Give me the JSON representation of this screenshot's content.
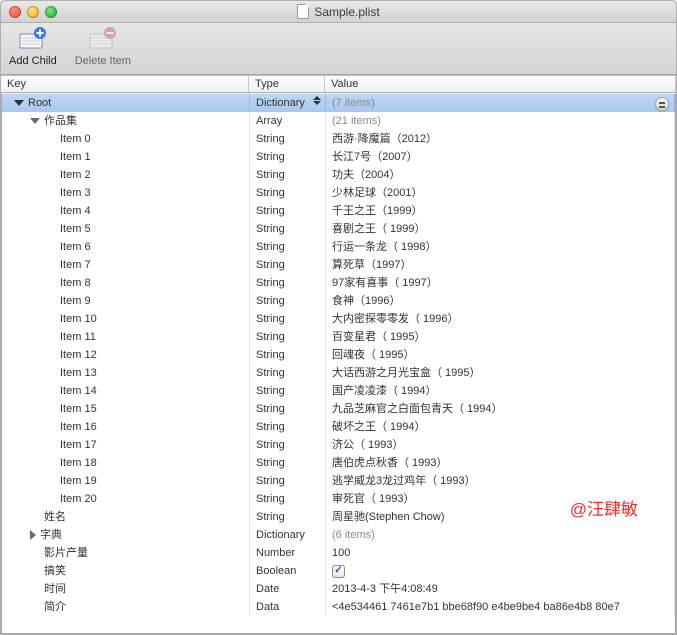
{
  "title": "Sample.plist",
  "toolbar": {
    "add_child": "Add Child",
    "delete_item": "Delete Item"
  },
  "columns": {
    "key": "Key",
    "type": "Type",
    "value": "Value"
  },
  "rows": [
    {
      "depth": 0,
      "disclosure": "down",
      "selected": true,
      "key": "Root",
      "type": "Dictionary",
      "value": "(7 items)",
      "value_dim": true,
      "interactable": true
    },
    {
      "depth": 1,
      "disclosure": "down",
      "key": "作品集",
      "type": "Array",
      "value": "(21 items)",
      "value_dim": true,
      "interactable": true
    },
    {
      "depth": 2,
      "key": "Item 0",
      "type": "String",
      "value": "西游·降魔篇（2012）",
      "interactable": true
    },
    {
      "depth": 2,
      "key": "Item 1",
      "type": "String",
      "value": "长江7号（2007）",
      "interactable": true
    },
    {
      "depth": 2,
      "key": "Item 2",
      "type": "String",
      "value": "功夫（2004）",
      "interactable": true
    },
    {
      "depth": 2,
      "key": "Item 3",
      "type": "String",
      "value": "少林足球（2001）",
      "interactable": true
    },
    {
      "depth": 2,
      "key": "Item 4",
      "type": "String",
      "value": "千王之王（1999）",
      "interactable": true
    },
    {
      "depth": 2,
      "key": "Item 5",
      "type": "String",
      "value": "喜剧之王（ 1999）",
      "interactable": true
    },
    {
      "depth": 2,
      "key": "Item 6",
      "type": "String",
      "value": "行运一条龙（ 1998）",
      "interactable": true
    },
    {
      "depth": 2,
      "key": "Item 7",
      "type": "String",
      "value": "算死草（1997）",
      "interactable": true
    },
    {
      "depth": 2,
      "key": "Item 8",
      "type": "String",
      "value": "97家有喜事（ 1997）",
      "interactable": true
    },
    {
      "depth": 2,
      "key": "Item 9",
      "type": "String",
      "value": "食神（1996）",
      "interactable": true
    },
    {
      "depth": 2,
      "key": "Item 10",
      "type": "String",
      "value": "大内密探零零发（ 1996）",
      "interactable": true
    },
    {
      "depth": 2,
      "key": "Item 11",
      "type": "String",
      "value": "百变星君（ 1995）",
      "interactable": true
    },
    {
      "depth": 2,
      "key": "Item 12",
      "type": "String",
      "value": "回魂夜（ 1995）",
      "interactable": true
    },
    {
      "depth": 2,
      "key": "Item 13",
      "type": "String",
      "value": "大话西游之月光宝盒（ 1995）",
      "interactable": true
    },
    {
      "depth": 2,
      "key": "Item 14",
      "type": "String",
      "value": "国产凌凌漆（ 1994）",
      "interactable": true
    },
    {
      "depth": 2,
      "key": "Item 15",
      "type": "String",
      "value": "九品芝麻官之白面包青天（ 1994）",
      "interactable": true
    },
    {
      "depth": 2,
      "key": "Item 16",
      "type": "String",
      "value": "破坏之王（ 1994）",
      "interactable": true
    },
    {
      "depth": 2,
      "key": "Item 17",
      "type": "String",
      "value": "济公（ 1993）",
      "interactable": true
    },
    {
      "depth": 2,
      "key": "Item 18",
      "type": "String",
      "value": "唐伯虎点秋香（ 1993）",
      "interactable": true
    },
    {
      "depth": 2,
      "key": "Item 19",
      "type": "String",
      "value": "逃学威龙3龙过鸡年（ 1993）",
      "interactable": true
    },
    {
      "depth": 2,
      "key": "Item 20",
      "type": "String",
      "value": "审死官（ 1993）",
      "interactable": true
    },
    {
      "depth": 1,
      "key": "姓名",
      "type": "String",
      "value": "周星驰(Stephen Chow)",
      "interactable": true
    },
    {
      "depth": 1,
      "disclosure": "right",
      "key": "字典",
      "type": "Dictionary",
      "value": "(6 items)",
      "value_dim": true,
      "interactable": true
    },
    {
      "depth": 1,
      "key": "影片产量",
      "type": "Number",
      "value": "100",
      "interactable": true
    },
    {
      "depth": 1,
      "key": "搞笑",
      "type": "Boolean",
      "value_special": "checkbox",
      "interactable": true
    },
    {
      "depth": 1,
      "key": "时间",
      "type": "Date",
      "value": "2013-4-3 下午4:08:49",
      "interactable": true
    },
    {
      "depth": 1,
      "key": "简介",
      "type": "Data",
      "value": "<4e534461 7461e7b1 bbe68f90 e4be9be4 ba86e4b8 80e7",
      "interactable": true
    }
  ],
  "watermark": "@汪肆敏"
}
